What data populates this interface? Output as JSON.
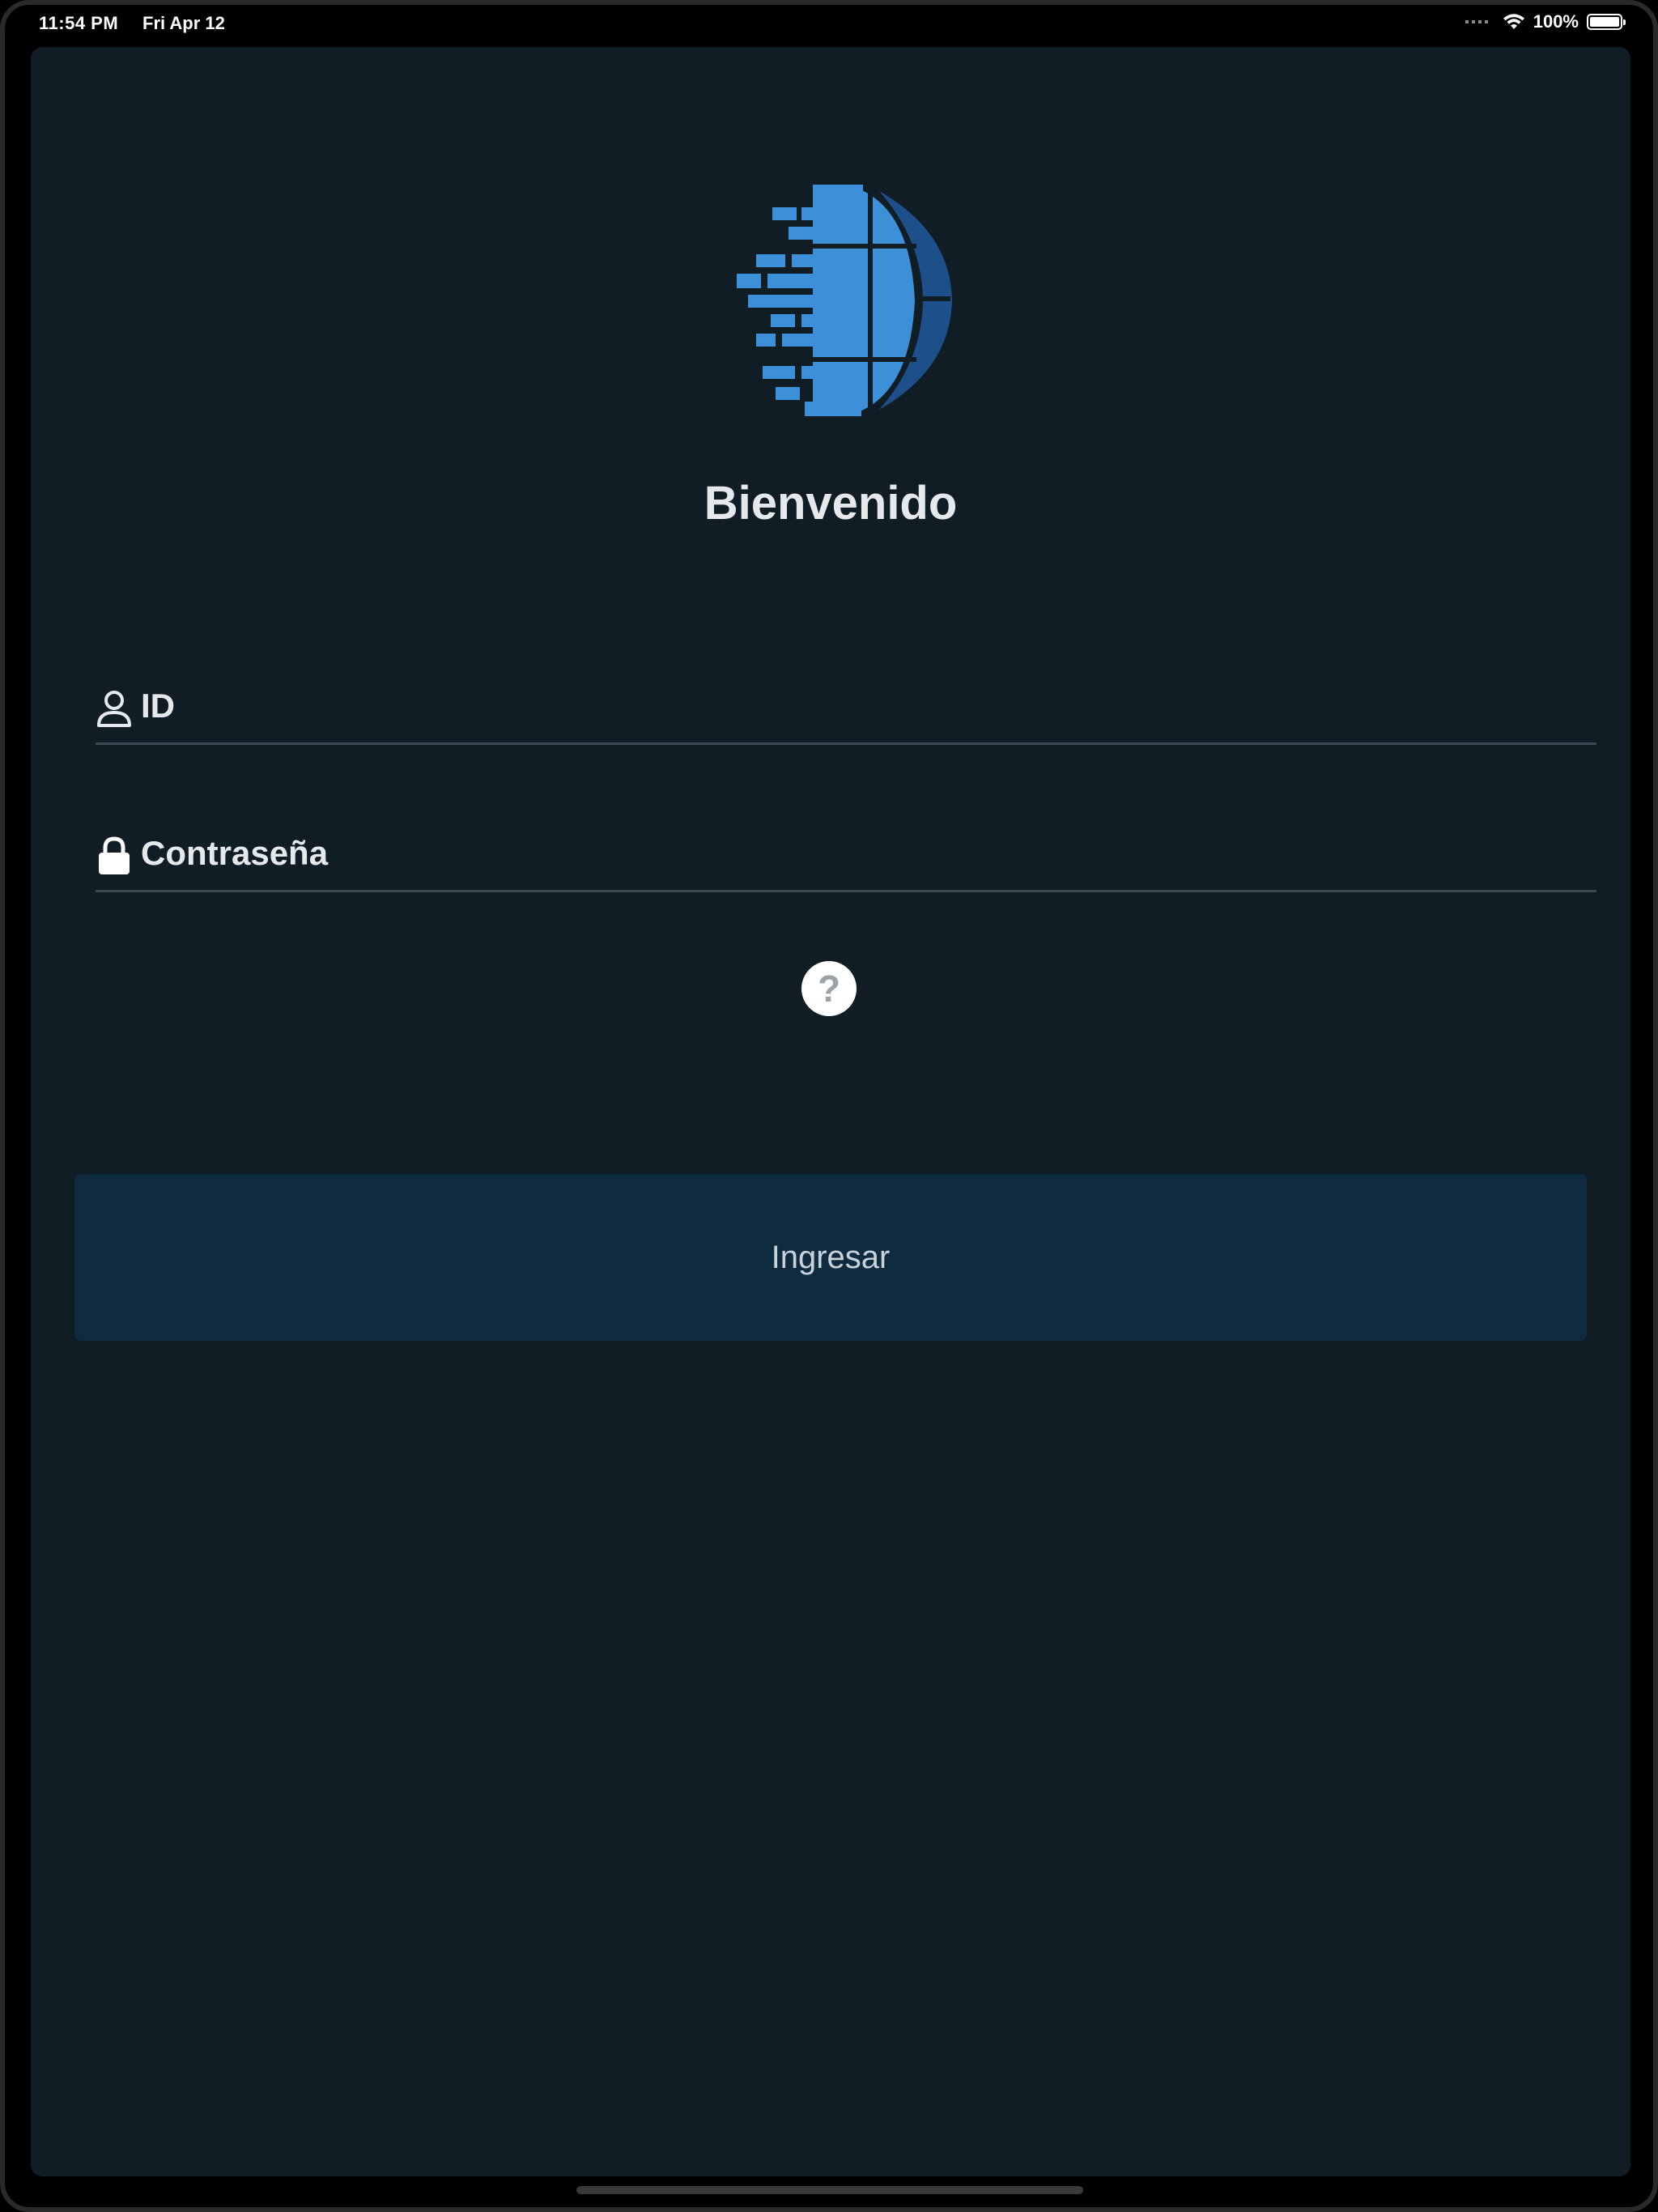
{
  "status_bar": {
    "time": "11:54 PM",
    "date": "Fri Apr 12",
    "battery_text": "100%",
    "battery_level": 1.0
  },
  "login": {
    "title": "Bienvenido",
    "id_placeholder": "ID",
    "password_placeholder": "Contraseña",
    "help_label": "?",
    "submit_label": "Ingresar"
  },
  "icons": {
    "logo": "globe-pixel-logo",
    "id_field": "user-icon",
    "password_field": "lock-icon",
    "help": "question-circle-icon",
    "wifi": "wifi-icon",
    "battery": "battery-icon"
  },
  "colors": {
    "background": "#101d24",
    "button": "#0f2b40",
    "logo_light": "#3d8fd8",
    "logo_dark": "#1d4f8a",
    "text": "#e6e9eb"
  }
}
